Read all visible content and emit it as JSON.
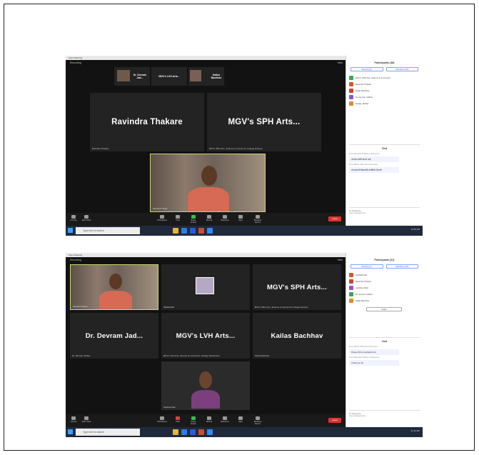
{
  "screenshot1": {
    "app_title": "Zoom Meeting",
    "recording": "Recording",
    "view": "View",
    "top_strip": [
      {
        "label": "Dr. Devram Jad...",
        "caption": "Dr. Devram Jadhav"
      },
      {
        "label": "MGV's LVH Arts...",
        "caption": "MGV's LVH Arts, Science & Commerce"
      },
      {
        "label": "Kailas Bachhav",
        "caption": "Kailas Bachhav"
      }
    ],
    "tiles": [
      {
        "label": "Ravindra Thakare",
        "caption": "Ravindra Thakare"
      },
      {
        "label": "MGV's SPH Arts...",
        "caption": "MGV's SPH Arts, Science & Commerce College Nampur"
      }
    ],
    "speaker_caption": "Ravindra Thakare",
    "controls": [
      "Unmute",
      "Start Video",
      "Participants",
      "Chat",
      "Share Screen",
      "Record",
      "Reactions",
      "Apps",
      "Breakout Rooms"
    ],
    "end": "Leave",
    "search": "Type here to search",
    "tray_time": "11:05 AM",
    "panel_title": "Participants (38)",
    "panel_tabs": [
      "Meeting (5)",
      "Attendees (33)"
    ],
    "participants": [
      "MGV's SPH Arts, Science & Commerce",
      "Ravindra Thakare",
      "Kailas Bachhav",
      "Dr. Devram Jadhav",
      "Sanjay Jadhav"
    ],
    "chat_title": "Chat",
    "chat_messages": [
      {
        "from": "From Ravindra Thakare to Everyone:",
        "text": "आपल्या सर्वांचे स्वागत आहे"
      },
      {
        "from": "From MGV's SPH Arts to Everyone:",
        "text": "सर्व सहभागी विद्यार्थ्यांनी उपस्थिती नोंदवावी"
      }
    ],
    "chat_to": "To: Everyone",
    "chat_placeholder": "Type message here..."
  },
  "screenshot2": {
    "app_title": "Zoom Meeting",
    "recording": "Recording",
    "view": "View",
    "tiles": [
      {
        "label": "",
        "caption": "Ravindra Thakare"
      },
      {
        "label": "",
        "caption": "Vaishali Patil"
      },
      {
        "label": "MGV's SPH Arts...",
        "caption": "MGV's SPH Arts, Science & Commerce College Nampur"
      },
      {
        "label": "Dr. Devram Jad...",
        "caption": "Dr. Devram Jadhav"
      },
      {
        "label": "MGV's LVH Arts...",
        "caption": "MGV's LVH Arts, Science & Commerce College Panchavati"
      },
      {
        "label": "Kailas Bachhav",
        "caption": "Kailas Bachhav"
      },
      {
        "label": "",
        "caption": "Jayshree Patil"
      }
    ],
    "controls": [
      "Unmute",
      "Start Video",
      "Participants",
      "Chat",
      "Share Screen",
      "Record",
      "Reactions",
      "Apps",
      "Breakout Rooms"
    ],
    "end": "Leave",
    "search": "Type here to search",
    "tray_time": "11:42 AM",
    "panel_title": "Participants (41)",
    "panel_tabs": [
      "Meeting (7)",
      "Attendees (34)"
    ],
    "participants": [
      "Vaishali Patil",
      "Ravindra Thakare",
      "Jayshree Patil",
      "Dr. Devram Jadhav",
      "Kailas Bachhav"
    ],
    "invite": "Invite",
    "chat_title": "Chat",
    "chat_messages": [
      {
        "from": "From MGV's SPH Arts to Everyone:",
        "text": "Please fill the feedback form"
      },
      {
        "from": "From Ravindra Thakare to Everyone:",
        "text": "Thank you all"
      }
    ],
    "chat_to": "To: Everyone",
    "chat_placeholder": "Type message here..."
  }
}
